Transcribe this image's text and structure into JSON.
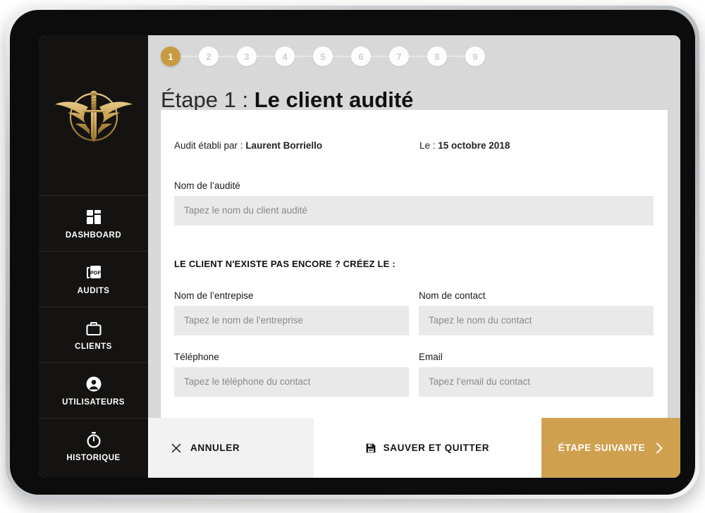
{
  "app": {
    "logo_name": "winged-sword-emblem"
  },
  "sidebar": {
    "items": [
      {
        "label": "DASHBOARD",
        "icon": "grid-icon"
      },
      {
        "label": "AUDITS",
        "icon": "pdf-file-icon"
      },
      {
        "label": "CLIENTS",
        "icon": "briefcase-icon"
      },
      {
        "label": "UTILISATEURS",
        "icon": "user-icon"
      },
      {
        "label": "HISTORIQUE",
        "icon": "stopwatch-icon"
      }
    ]
  },
  "stepper": {
    "steps": [
      "1",
      "2",
      "3",
      "4",
      "5",
      "6",
      "7",
      "8",
      "9"
    ],
    "active_index": 0,
    "active_color": "#c89a42",
    "inactive_color": "#fdfdfd",
    "inactive_text_color": "#cfcfcf"
  },
  "title": {
    "prefix": "Étape 1 : ",
    "emphasis": "Le client audité"
  },
  "meta": {
    "author_label": "Audit établi par : ",
    "author_value": "Laurent Borriello",
    "date_label": "Le : ",
    "date_value": "15 octobre 2018"
  },
  "form": {
    "audite": {
      "label": "Nom de l’audité",
      "placeholder": "Tapez le nom du client audité",
      "value": ""
    },
    "section_heading": "LE CLIENT N'EXISTE PAS ENCORE ? CRÉEZ LE :",
    "entreprise": {
      "label": "Nom de l’entrepise",
      "placeholder": "Tapez le nom de l’entreprise",
      "value": ""
    },
    "contact": {
      "label": "Nom de contact",
      "placeholder": "Tapez le nom du contact",
      "value": ""
    },
    "telephone": {
      "label": "Téléphone",
      "placeholder": "Tapez le téléphone du contact",
      "value": ""
    },
    "email": {
      "label": "Email",
      "placeholder": "Tapez l’email du contact",
      "value": ""
    }
  },
  "actions": {
    "cancel": {
      "label": "ANNULER",
      "icon": "close-icon"
    },
    "save": {
      "label": "SAUVER ET QUITTER",
      "icon": "floppy-save-icon"
    },
    "next": {
      "label": "ÉTAPE SUIVANTE",
      "icon": "chevron-right-icon",
      "color": "#cfa14f"
    }
  }
}
